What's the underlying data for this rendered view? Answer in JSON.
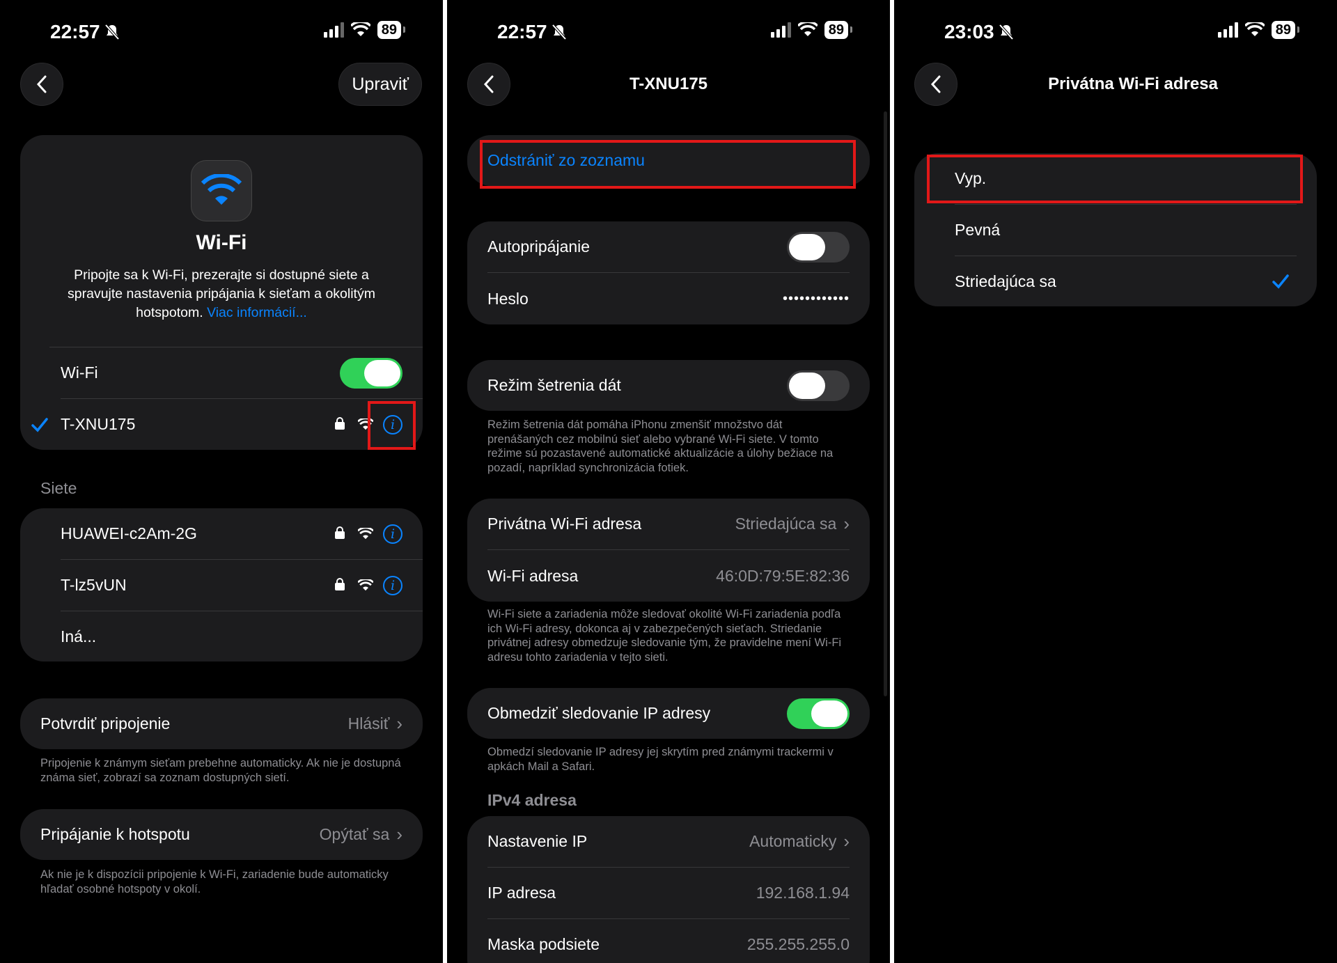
{
  "colors": {
    "accent": "#0a84ff",
    "toggle_on": "#30d158",
    "highlight": "#e21818",
    "card": "#1c1c1e"
  },
  "panel1": {
    "time": "22:57",
    "battery": "89",
    "edit_label": "Upraviť",
    "wifi_title": "Wi-Fi",
    "description": "Pripojte sa k Wi-Fi, prezerajte si dostupné siete a spravujte nastavenia pripájania k sieťam a okolitým hotspotom.",
    "more_info_link": "Viac informácií...",
    "wifi_toggle_label": "Wi-Fi",
    "wifi_on": true,
    "connected_network": "T-XNU175",
    "networks_header": "Siete",
    "networks": [
      {
        "name": "HUAWEI-c2Am-2G"
      },
      {
        "name": "T-lz5vUN"
      }
    ],
    "other_label": "Iná...",
    "ask_to_join_label": "Potvrdiť pripojenie",
    "ask_to_join_value": "Hlásiť",
    "ask_to_join_footer": "Pripojenie k známym sieťam prebehne automaticky. Ak nie je dostupná známa sieť, zobrazí sa zoznam dostupných sietí.",
    "hotspot_label": "Pripájanie k hotspotu",
    "hotspot_value": "Opýtať sa",
    "hotspot_footer": "Ak nie je k dispozícii pripojenie k Wi-Fi, zariadenie bude automaticky hľadať osobné hotspoty v okolí."
  },
  "panel2": {
    "time": "22:57",
    "battery": "89",
    "title": "T-XNU175",
    "forget_label": "Odstrániť zo zoznamu",
    "auto_join_label": "Autopripájanie",
    "auto_join_on": false,
    "password_label": "Heslo",
    "password_value": "••••••••••••",
    "low_data_label": "Režim šetrenia dát",
    "low_data_on": false,
    "low_data_footer": "Režim šetrenia dát pomáha iPhonu zmenšiť množstvo dát prenášaných cez mobilnú sieť alebo vybrané Wi-Fi siete. V tomto režime sú pozastavené automatické aktualizácie a úlohy bežiace na pozadí, napríklad synchronizácia fotiek.",
    "private_addr_label": "Privátna Wi-Fi adresa",
    "private_addr_value": "Striedajúca sa",
    "wifi_addr_label": "Wi-Fi adresa",
    "wifi_addr_value": "46:0D:79:5E:82:36",
    "private_footer": "Wi-Fi siete a zariadenia môže sledovať okolité Wi-Fi zariadenia podľa ich Wi-Fi adresy, dokonca aj v zabezpečených sieťach. Striedanie privátnej adresy obmedzuje sledovanie tým, že pravidelne mení Wi-Fi adresu tohto zariadenia v tejto sieti.",
    "limit_ip_label": "Obmedziť sledovanie IP adresy",
    "limit_ip_on": true,
    "limit_ip_footer": "Obmedzí sledovanie IP adresy jej skrytím pred známymi trackermi v apkách Mail a Safari.",
    "ipv4_header": "IPv4 adresa",
    "configure_ip_label": "Nastavenie IP",
    "configure_ip_value": "Automaticky",
    "ip_label": "IP adresa",
    "ip_value": "192.168.1.94",
    "mask_label": "Maska podsiete",
    "mask_value": "255.255.255.0"
  },
  "panel3": {
    "time": "23:03",
    "battery": "89",
    "title": "Privátna Wi-Fi adresa",
    "options": [
      "Vyp.",
      "Pevná",
      "Striedajúca sa"
    ],
    "selected_option": "Striedajúca sa"
  }
}
